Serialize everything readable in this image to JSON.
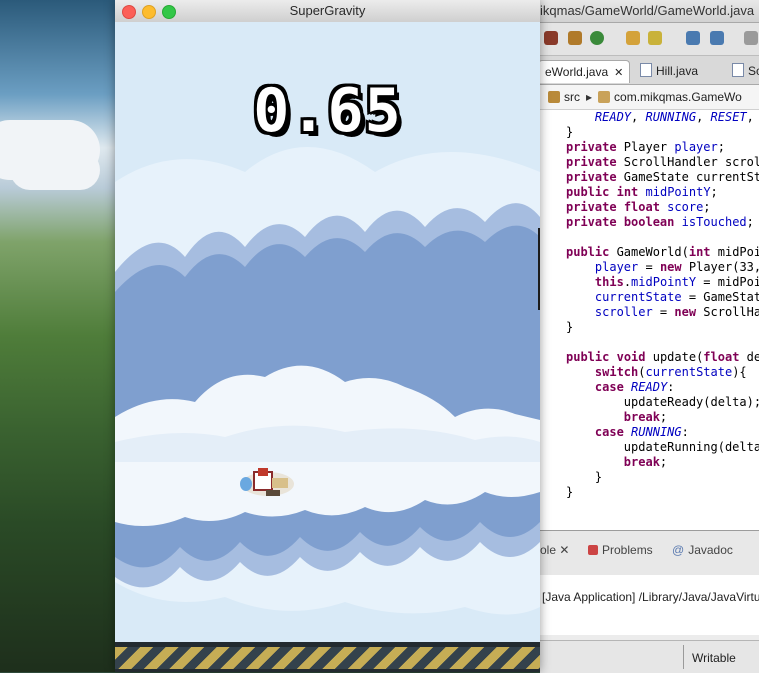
{
  "game_window": {
    "title": "SuperGravity",
    "score": "0.65"
  },
  "eclipse": {
    "window_title_fragment": "ikqmas/GameWorld/GameWorld.java",
    "tabs": [
      {
        "label": "eWorld.java",
        "active": true
      },
      {
        "label": "Hill.java",
        "active": false
      },
      {
        "label": "Sc",
        "active": false
      }
    ],
    "breadcrumb": {
      "folder": "src",
      "package": "com.mikqmas.GameWo"
    },
    "code_lines": [
      "    READY, RUNNING, RESET, C",
      "}",
      "private Player player;",
      "private ScrollHandler scroll",
      "private GameState currentSta",
      "public int midPointY;",
      "private float score;",
      "private boolean isTouched;",
      "",
      "public GameWorld(int midPoi",
      "    player = new Player(33,",
      "    this.midPointY = midPoin",
      "    currentState = GameState",
      "    scroller = new ScrollHan",
      "}",
      "",
      "public void update(float del",
      "    switch(currentState){",
      "    case READY:",
      "        updateReady(delta);",
      "        break;",
      "    case RUNNING:",
      "        updateRunning(delta)",
      "        break;",
      "    }",
      "}"
    ],
    "bottom_tabs": {
      "console": "ole",
      "problems": "Problems",
      "javadoc": "Javadoc"
    },
    "console_line": "[Java Application] /Library/Java/JavaVirtu",
    "status": "Writable"
  },
  "colors": {
    "sky": "#e7f2fb",
    "cloud_dark": "#7f9fcf",
    "cloud_light": "#f2f7fc",
    "ground_stripe_a": "#c6ad55",
    "ground_stripe_b": "#34424c",
    "keyword": "#7f0055",
    "field": "#0000c0"
  }
}
